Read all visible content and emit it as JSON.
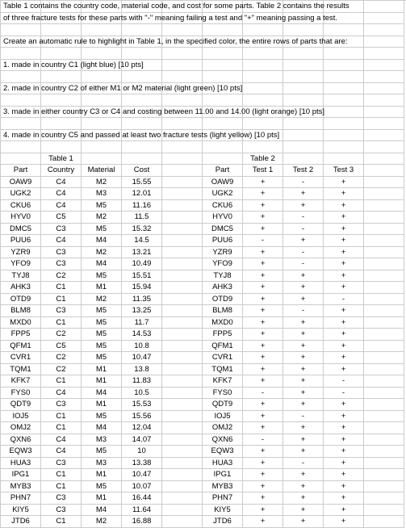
{
  "instructions": {
    "line1": "Table 1 contains the country code, material code, and cost for some parts. Table 2 contains the results",
    "line2": "of three fracture tests for these parts with \"-\" meaning  failing a test and \"+\" meaning passing a test.",
    "line3": "Create an automatic rule to highlight in Table 1, in the specified color, the entire rows of parts that are:",
    "rule1": "1. made in country C1 (light blue) [10 pts]",
    "rule2": "2. made in country C2 of either M1 or M2 material (light green) [10 pts]",
    "rule3": "3. made in either country C3 or C4 and costing between 11.00 and 14.00 (light orange) [10 pts]",
    "rule4": "4. made in country C5 and passed at least two fracture tests (light yellow) [10 pts]"
  },
  "table1": {
    "title": "Table 1",
    "headers": {
      "part": "Part",
      "country": "Country",
      "material": "Material",
      "cost": "Cost"
    },
    "rows": [
      {
        "part": "OAW9",
        "country": "C4",
        "material": "M2",
        "cost": "15.55"
      },
      {
        "part": "UGK2",
        "country": "C4",
        "material": "M3",
        "cost": "12.01"
      },
      {
        "part": "CKU6",
        "country": "C4",
        "material": "M5",
        "cost": "11.16"
      },
      {
        "part": "HYV0",
        "country": "C5",
        "material": "M2",
        "cost": "11.5"
      },
      {
        "part": "DMC5",
        "country": "C3",
        "material": "M5",
        "cost": "15.32"
      },
      {
        "part": "PUU6",
        "country": "C4",
        "material": "M4",
        "cost": "14.5"
      },
      {
        "part": "YZR9",
        "country": "C3",
        "material": "M2",
        "cost": "13.21"
      },
      {
        "part": "YFO9",
        "country": "C3",
        "material": "M4",
        "cost": "10.49"
      },
      {
        "part": "TYJ8",
        "country": "C2",
        "material": "M5",
        "cost": "15.51"
      },
      {
        "part": "AHK3",
        "country": "C1",
        "material": "M1",
        "cost": "15.94"
      },
      {
        "part": "OTD9",
        "country": "C1",
        "material": "M2",
        "cost": "11.35"
      },
      {
        "part": "BLM8",
        "country": "C3",
        "material": "M5",
        "cost": "13.25"
      },
      {
        "part": "MXD0",
        "country": "C1",
        "material": "M5",
        "cost": "11.7"
      },
      {
        "part": "FPP5",
        "country": "C2",
        "material": "M5",
        "cost": "14.53"
      },
      {
        "part": "QFM1",
        "country": "C5",
        "material": "M5",
        "cost": "10.8"
      },
      {
        "part": "CVR1",
        "country": "C2",
        "material": "M5",
        "cost": "10.47"
      },
      {
        "part": "TQM1",
        "country": "C2",
        "material": "M1",
        "cost": "13.8"
      },
      {
        "part": "KFK7",
        "country": "C1",
        "material": "M1",
        "cost": "11.83"
      },
      {
        "part": "FYS0",
        "country": "C4",
        "material": "M4",
        "cost": "10.5"
      },
      {
        "part": "QDT9",
        "country": "C3",
        "material": "M1",
        "cost": "15.53"
      },
      {
        "part": "IOJ5",
        "country": "C1",
        "material": "M5",
        "cost": "15.56"
      },
      {
        "part": "OMJ2",
        "country": "C1",
        "material": "M4",
        "cost": "12.04"
      },
      {
        "part": "QXN6",
        "country": "C4",
        "material": "M3",
        "cost": "14.07"
      },
      {
        "part": "EQW3",
        "country": "C4",
        "material": "M5",
        "cost": "10"
      },
      {
        "part": "HUA3",
        "country": "C3",
        "material": "M3",
        "cost": "13.38"
      },
      {
        "part": "IPG1",
        "country": "C1",
        "material": "M1",
        "cost": "10.47"
      },
      {
        "part": "MYB3",
        "country": "C1",
        "material": "M5",
        "cost": "10.07"
      },
      {
        "part": "PHN7",
        "country": "C3",
        "material": "M1",
        "cost": "16.44"
      },
      {
        "part": "KIY5",
        "country": "C3",
        "material": "M4",
        "cost": "11.64"
      },
      {
        "part": "JTD6",
        "country": "C1",
        "material": "M2",
        "cost": "16.88"
      }
    ]
  },
  "table2": {
    "title": "Table 2",
    "headers": {
      "part": "Part",
      "t1": "Test 1",
      "t2": "Test 2",
      "t3": "Test 3"
    },
    "rows": [
      {
        "part": "OAW9",
        "t1": "+",
        "t2": "-",
        "t3": "+"
      },
      {
        "part": "UGK2",
        "t1": "+",
        "t2": "+",
        "t3": "+"
      },
      {
        "part": "CKU6",
        "t1": "+",
        "t2": "+",
        "t3": "+"
      },
      {
        "part": "HYV0",
        "t1": "+",
        "t2": "-",
        "t3": "+"
      },
      {
        "part": "DMC5",
        "t1": "+",
        "t2": "-",
        "t3": "+"
      },
      {
        "part": "PUU6",
        "t1": "-",
        "t2": "+",
        "t3": "+"
      },
      {
        "part": "YZR9",
        "t1": "+",
        "t2": "-",
        "t3": "+"
      },
      {
        "part": "YFO9",
        "t1": "+",
        "t2": "-",
        "t3": "+"
      },
      {
        "part": "TYJ8",
        "t1": "+",
        "t2": "+",
        "t3": "+"
      },
      {
        "part": "AHK3",
        "t1": "+",
        "t2": "+",
        "t3": "+"
      },
      {
        "part": "OTD9",
        "t1": "+",
        "t2": "+",
        "t3": "-"
      },
      {
        "part": "BLM8",
        "t1": "+",
        "t2": "-",
        "t3": "+"
      },
      {
        "part": "MXD0",
        "t1": "+",
        "t2": "+",
        "t3": "+"
      },
      {
        "part": "FPP5",
        "t1": "+",
        "t2": "+",
        "t3": "+"
      },
      {
        "part": "QFM1",
        "t1": "+",
        "t2": "+",
        "t3": "+"
      },
      {
        "part": "CVR1",
        "t1": "+",
        "t2": "+",
        "t3": "+"
      },
      {
        "part": "TQM1",
        "t1": "+",
        "t2": "+",
        "t3": "+"
      },
      {
        "part": "KFK7",
        "t1": "+",
        "t2": "+",
        "t3": "-"
      },
      {
        "part": "FYS0",
        "t1": "-",
        "t2": "+",
        "t3": "-"
      },
      {
        "part": "QDT9",
        "t1": "+",
        "t2": "+",
        "t3": "+"
      },
      {
        "part": "IOJ5",
        "t1": "+",
        "t2": "-",
        "t3": "+"
      },
      {
        "part": "OMJ2",
        "t1": "+",
        "t2": "+",
        "t3": "+"
      },
      {
        "part": "QXN6",
        "t1": "-",
        "t2": "+",
        "t3": "+"
      },
      {
        "part": "EQW3",
        "t1": "+",
        "t2": "+",
        "t3": "+"
      },
      {
        "part": "HUA3",
        "t1": "+",
        "t2": "-",
        "t3": "+"
      },
      {
        "part": "IPG1",
        "t1": "+",
        "t2": "+",
        "t3": "+"
      },
      {
        "part": "MYB3",
        "t1": "+",
        "t2": "+",
        "t3": "+"
      },
      {
        "part": "PHN7",
        "t1": "+",
        "t2": "+",
        "t3": "+"
      },
      {
        "part": "KIY5",
        "t1": "+",
        "t2": "+",
        "t3": "+"
      },
      {
        "part": "JTD6",
        "t1": "+",
        "t2": "+",
        "t3": "+"
      }
    ]
  }
}
